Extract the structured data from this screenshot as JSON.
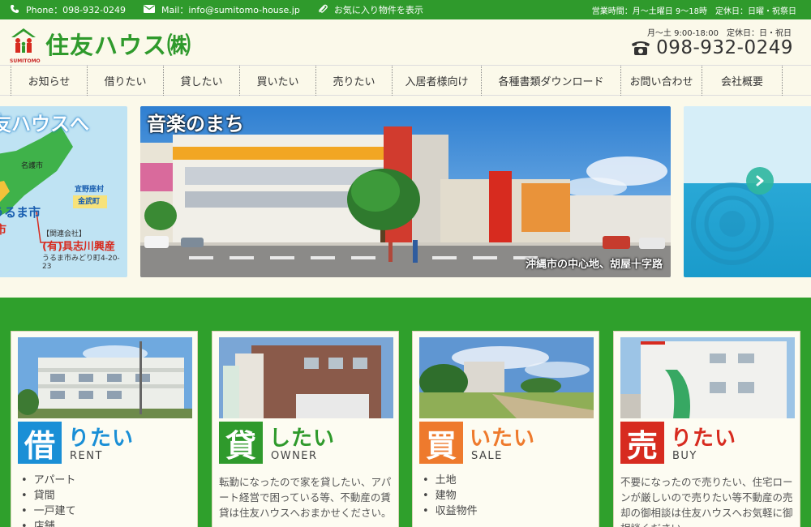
{
  "topbar": {
    "phone": "Phone：098-932-0249",
    "mail": "Mail：info@sumitomo-house.jp",
    "favorites": "お気に入り物件を表示",
    "hours": "営業時間：月～土曜日 9～18時",
    "closed": "定休日：日曜・祝祭日"
  },
  "header": {
    "logo_text": "住友ハウス㈱",
    "logo_sub": "SUMITOMO",
    "hours": "月～土 9:00-18:00　定休日：日・祝日",
    "phone": "098-932-0249"
  },
  "nav": {
    "items": [
      {
        "label": "お知らせ"
      },
      {
        "label": "借りたい"
      },
      {
        "label": "貸したい"
      },
      {
        "label": "買いたい"
      },
      {
        "label": "売りたい"
      },
      {
        "label": "入居者様向け"
      },
      {
        "label": "各種書類ダウンロード"
      },
      {
        "label": "お問い合わせ"
      },
      {
        "label": "会社概要"
      }
    ]
  },
  "slider": {
    "left": {
      "heading": "友ハウスへ",
      "place1": "名護市",
      "place2": "宜野座村",
      "place3": "金武町",
      "city": "うるま市",
      "city2": "市",
      "related": "【関連会社】",
      "company": "(有)具志川興産",
      "address": "うるま市みどり町4-20-23"
    },
    "main": {
      "title": "音楽のまち",
      "caption": "沖縄市の中心地、胡屋十字路"
    }
  },
  "cards": [
    {
      "kanji": "借",
      "kana": "りたい",
      "eng": "RENT",
      "color": "#1a8fd6",
      "items": [
        "アパート",
        "貸間",
        "一戸建て",
        "店舗"
      ]
    },
    {
      "kanji": "貸",
      "kana": "したい",
      "eng": "OWNER",
      "color": "#2f9a2c",
      "desc": "転勤になったので家を貸したい、アパート経営で困っている等、不動産の賃貸は住友ハウスへおまかせください。"
    },
    {
      "kanji": "買",
      "kana": "いたい",
      "eng": "SALE",
      "color": "#ee7a2d",
      "items": [
        "土地",
        "建物",
        "収益物件"
      ]
    },
    {
      "kanji": "売",
      "kana": "りたい",
      "eng": "BUY",
      "color": "#d72b1f",
      "desc": "不要になったので売りたい、住宅ローンが厳しいので売りたい等不動産の売却の御相談は住友ハウスへお気軽に御相談ください。"
    }
  ]
}
